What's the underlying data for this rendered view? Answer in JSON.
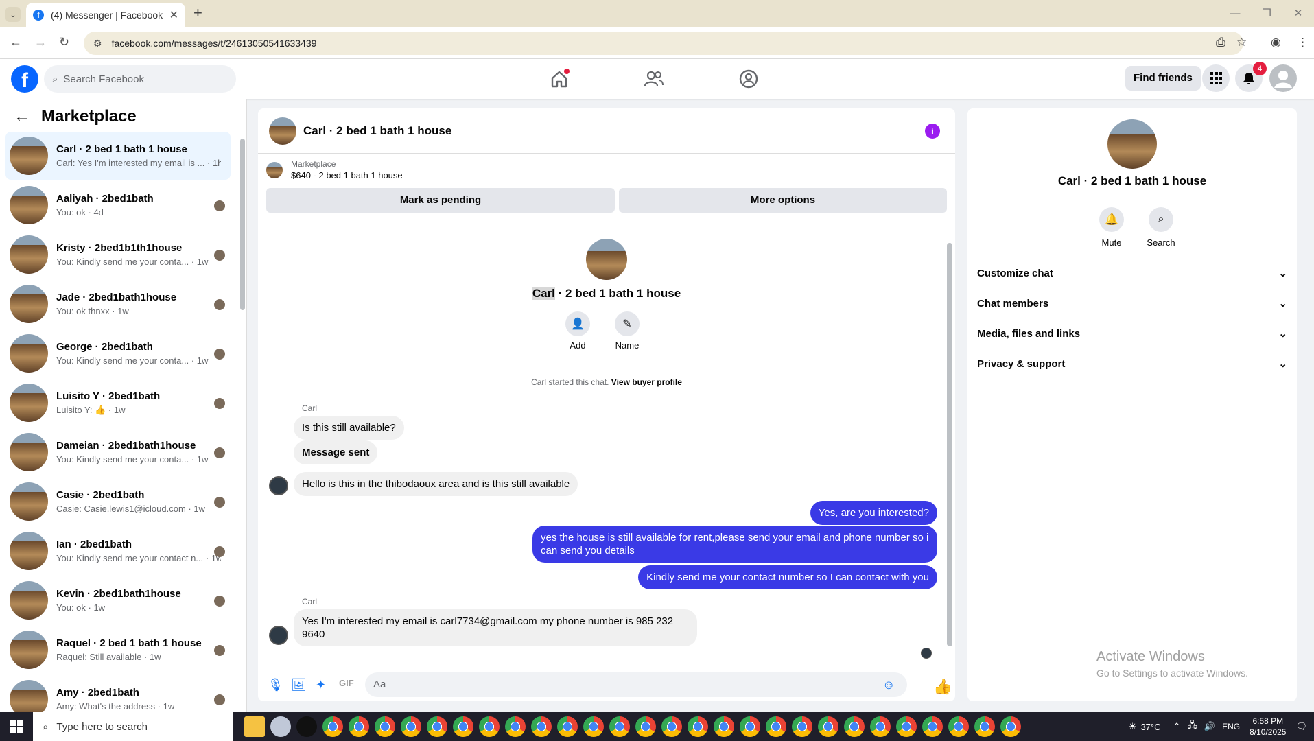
{
  "browser": {
    "tab_title": "(4) Messenger | Facebook",
    "url": "facebook.com/messages/t/24613050541633439"
  },
  "fb": {
    "search_placeholder": "Search Facebook",
    "find_friends": "Find friends",
    "notif_count": "4"
  },
  "sidebar": {
    "title": "Marketplace",
    "conversations": [
      {
        "name": "Carl · 2 bed 1 bath 1 house",
        "preview": "Carl: Yes I'm interested my email is ... · 1h",
        "active": true
      },
      {
        "name": "Aaliyah · 2bed1bath",
        "preview": "You: ok · 4d"
      },
      {
        "name": "Kristy · 2bed1b1th1house",
        "preview": "You: Kindly send me your conta... · 1w"
      },
      {
        "name": "Jade · 2bed1bath1house",
        "preview": "You: ok thnxx · 1w"
      },
      {
        "name": "George · 2bed1bath",
        "preview": "You: Kindly send me your conta... · 1w"
      },
      {
        "name": "Luisito Y · 2bed1bath",
        "preview": "Luisito Y: 👍 · 1w"
      },
      {
        "name": "Dameian · 2bed1bath1house",
        "preview": "You: Kindly send me your conta... · 1w"
      },
      {
        "name": "Casie · 2bed1bath",
        "preview": "Casie: Casie.lewis1@icloud.com · 1w"
      },
      {
        "name": "Ian · 2bed1bath",
        "preview": "You: Kindly send me your contact n... · 1w"
      },
      {
        "name": "Kevin · 2bed1bath1house",
        "preview": "You: ok · 1w"
      },
      {
        "name": "Raquel · 2 bed 1 bath 1 house",
        "preview": "Raquel: Still available · 1w"
      },
      {
        "name": "Amy · 2bed1bath",
        "preview": "Amy: What's the address · 1w"
      }
    ]
  },
  "chat": {
    "title": "Carl · 2 bed 1 bath 1 house",
    "marketplace_label": "Marketplace",
    "listing": "$640 - 2 bed 1 bath 1 house",
    "mark_pending": "Mark as pending",
    "more_options": "More options",
    "profile_first": "Carl",
    "profile_rest": " · 2 bed 1 bath 1 house",
    "add_label": "Add",
    "name_label": "Name",
    "started_text": "Carl started this chat. ",
    "view_profile": "View buyer profile",
    "sender_name": "Carl",
    "msg1": "Is this still available?",
    "msg2": "Message sent",
    "msg3": "Hello is this in the thibodaoux area and is this still available",
    "out1": "Yes, are you interested?",
    "out2": "yes the house is still available for rent,please send your email and phone number so i can send you details",
    "out3": "Kindly send me your contact number so I can contact with you",
    "msg4": "Yes I'm interested my email is carl7734@gmail.com my phone number is 985 232 9640",
    "composer_placeholder": "Aa"
  },
  "right": {
    "title": "Carl · 2 bed 1 bath 1 house",
    "mute": "Mute",
    "search": "Search",
    "items": [
      "Customize chat",
      "Chat members",
      "Media, files and links",
      "Privacy & support"
    ]
  },
  "windows": {
    "activate_title": "Activate Windows",
    "activate_sub": "Go to Settings to activate Windows."
  },
  "taskbar": {
    "search_placeholder": "Type here to search",
    "temperature": "37°C",
    "lang": "ENG",
    "time": "6:58 PM",
    "date": "8/10/2025"
  }
}
